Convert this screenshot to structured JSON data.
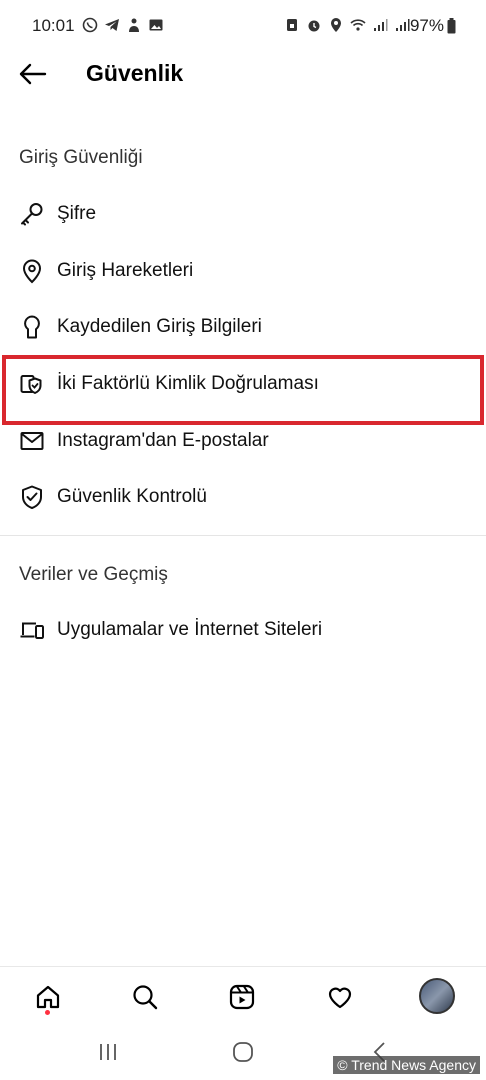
{
  "status_bar": {
    "time": "10:01",
    "battery": "97%",
    "left_icons": [
      "whatsapp-icon",
      "telegram-icon",
      "clubhouse-icon",
      "gallery-icon"
    ],
    "right_icons": [
      "sim-icon",
      "alarm-icon",
      "location-icon",
      "wifi-icon",
      "signal-icon",
      "signal-icon",
      "battery-icon"
    ]
  },
  "header": {
    "title": "Güvenlik",
    "back_icon": "arrow-left-icon"
  },
  "sections": {
    "login_security": {
      "title": "Giriş Güvenliği",
      "items": [
        {
          "label": "Şifre",
          "icon": "key-icon"
        },
        {
          "label": "Giriş Hareketleri",
          "icon": "location-pin-icon"
        },
        {
          "label": "Kaydedilen Giriş Bilgileri",
          "icon": "keyhole-icon"
        },
        {
          "label": "İki Faktörlü Kimlik Doğrulaması",
          "icon": "shield-check-icon",
          "highlighted": true
        },
        {
          "label": "Instagram'dan E-postalar",
          "icon": "mail-icon"
        },
        {
          "label": "Güvenlik Kontrolü",
          "icon": "shield-check-icon"
        }
      ]
    },
    "data_history": {
      "title": "Veriler ve Geçmiş",
      "items": [
        {
          "label": "Uygulamalar ve İnternet Siteleri",
          "icon": "laptop-phone-icon"
        }
      ]
    }
  },
  "bottom_nav": {
    "items": [
      "home-icon",
      "search-icon",
      "reels-icon",
      "heart-icon",
      "avatar"
    ]
  },
  "system_nav": {
    "items": [
      "recent-apps-icon",
      "home-circle-icon",
      "back-chevron-icon"
    ]
  },
  "watermark": "© Trend News Agency",
  "colors": {
    "highlight": "#d9272e",
    "notification_dot": "#ff3040",
    "text": "#111111"
  }
}
